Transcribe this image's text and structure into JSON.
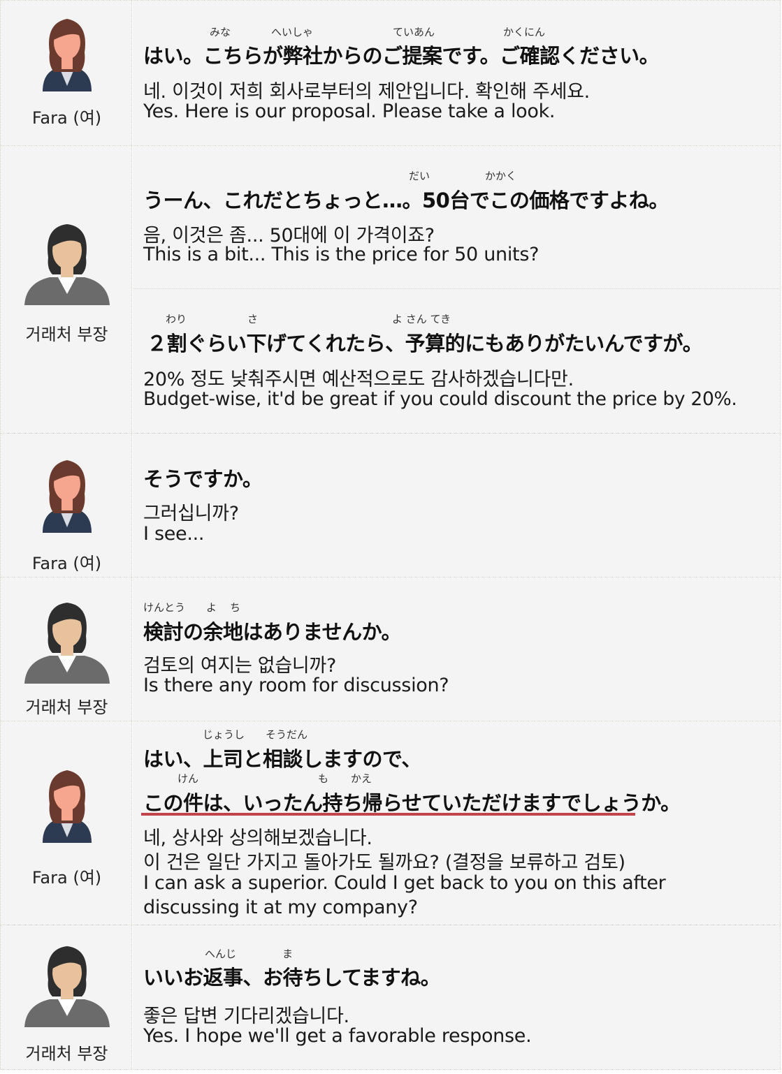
{
  "speakers": {
    "fara": "Fara (여)",
    "client": "거래처 부장"
  },
  "colors": {
    "cell_bg": "#f4f4f4",
    "border": "#cfd6c4",
    "underline": "#c0444a",
    "fara_hair": "#6b3a2e",
    "fara_skin": "#f6a58e",
    "fara_suit": "#2c3a52",
    "client_hair": "#2e2e2e",
    "client_skin": "#e7c29d",
    "client_suit": "#6b6b6b"
  },
  "icons": {
    "fara": "female-avatar-icon",
    "client": "female-manager-avatar-icon"
  },
  "dialogue": [
    {
      "speaker": "fara",
      "japanese": "はい。こちらが弊社からのご提案です。ご確認ください。",
      "ruby": [
        "みな",
        "へいしゃ",
        "ていあん",
        "かくにん"
      ],
      "korean": "네. 이것이 저희 회사로부터의 제안입니다. 확인해 주세요.",
      "english": "Yes. Here is our proposal. Please take a look."
    },
    {
      "speaker": "client",
      "japanese": "うーん、これだとちょっと…。50台でこの価格ですよね。",
      "ruby": [
        "だい",
        "かかく"
      ],
      "korean": "음, 이것은 좀... 50대에 이 가격이죠?",
      "english": "This is a bit... This is the price for 50 units?"
    },
    {
      "speaker": "client",
      "japanese": "２割ぐらい下げてくれたら、予算的にもありがたいんですが。",
      "ruby": [
        "わり",
        "さ",
        "よ さん てき"
      ],
      "korean": "20% 정도 낮춰주시면 예산적으로도 감사하겠습니다만.",
      "english": "Budget-wise, it'd be great if you could discount the price by 20%."
    },
    {
      "speaker": "fara",
      "japanese": "そうですか。",
      "ruby": [],
      "korean": "그러십니까?",
      "english": "I see..."
    },
    {
      "speaker": "client",
      "japanese": "検討の余地はありませんか。",
      "ruby": [
        "けんとう",
        "よ",
        "ち"
      ],
      "korean": "검토의 여지는 없습니까?",
      "english": "Is there any room for discussion?"
    },
    {
      "speaker": "fara",
      "japanese": "はい、上司と相談しますので、",
      "japanese_2": "この件は、いったん持ち帰らせていただけますでしょうか。",
      "ruby": [
        "じょうし",
        "そうだん"
      ],
      "ruby_2": [
        "けん",
        "も",
        "かえ"
      ],
      "korean": "네, 상사와 상의해보겠습니다.",
      "korean_2": "이 건은 일단 가지고 돌아가도 될까요? (결정을 보류하고 검토)",
      "english": "I can ask a superior. Could I get back to you on this after",
      "english_2": "discussing it at my company?"
    },
    {
      "speaker": "client",
      "japanese": "いいお返事、お待ちしてますね。",
      "ruby": [
        "へんじ",
        "ま"
      ],
      "korean": "좋은 답변 기다리겠습니다.",
      "english": "Yes. I hope we'll get a favorable response."
    }
  ]
}
